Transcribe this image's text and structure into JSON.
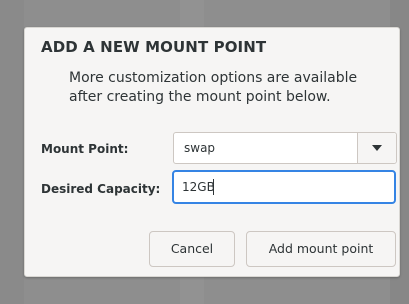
{
  "dialog": {
    "title": "ADD A NEW MOUNT POINT",
    "description": "More customization options are available after creating the mount point below.",
    "mount_point": {
      "label": "Mount Point:",
      "value": "swap",
      "dropdown_icon": "chevron-down-icon"
    },
    "desired_capacity": {
      "label": "Desired Capacity:",
      "value": "12GB"
    },
    "buttons": {
      "cancel": "Cancel",
      "add": "Add mount point"
    }
  },
  "colors": {
    "focus_border": "#3584e4",
    "dialog_bg": "#f6f5f4",
    "text": "#2e3436"
  }
}
